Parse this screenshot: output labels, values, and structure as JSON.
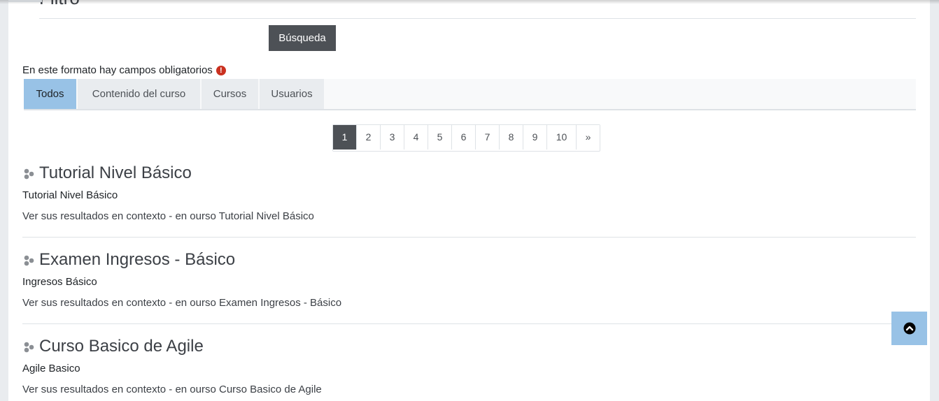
{
  "filter": {
    "legend": "Filtro",
    "search_button": "Búsqueda",
    "required_note": "En este formato hay campos obligatorios"
  },
  "tabs": [
    {
      "label": "Todos",
      "active": true
    },
    {
      "label": "Contenido del curso",
      "active": false
    },
    {
      "label": "Cursos",
      "active": false
    },
    {
      "label": "Usuarios",
      "active": false
    }
  ],
  "pagination": {
    "pages": [
      "1",
      "2",
      "3",
      "4",
      "5",
      "6",
      "7",
      "8",
      "9",
      "10",
      "»"
    ],
    "current": "1"
  },
  "results": [
    {
      "title": "Tutorial Nivel Básico",
      "course": "Tutorial Nivel Básico",
      "context": "Ver sus resultados en contexto - en ourso Tutorial Nivel Básico"
    },
    {
      "title": "Examen Ingresos - Básico",
      "course": "Ingresos Básico",
      "context": "Ver sus resultados en contexto - en ourso Examen Ingresos - Básico"
    },
    {
      "title": "Curso Basico de Agile",
      "course": "Agile Basico",
      "context": "Ver sus resultados en contexto - en ourso Curso Basico de Agile"
    }
  ],
  "icons": {
    "required": "exclamation-circle-icon",
    "result": "course-icon",
    "back_to_top": "chevron-up-circle-icon"
  },
  "colors": {
    "accent": "#98c2e6",
    "button_dark": "#4d5156",
    "required": "#ca3120"
  }
}
